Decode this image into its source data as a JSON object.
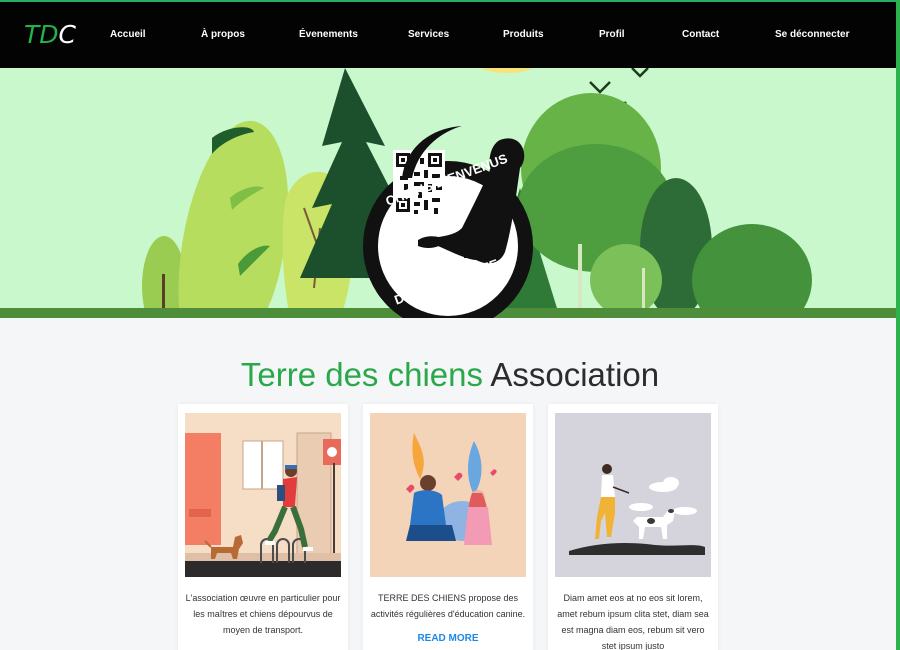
{
  "navbar": {
    "brand_part1": "TD",
    "brand_part2": "C",
    "items": [
      {
        "label": "Accueil"
      },
      {
        "label": "À propos"
      },
      {
        "label": "Évenements"
      },
      {
        "label": "Services"
      },
      {
        "label": "Produits"
      },
      {
        "label": "Profil"
      },
      {
        "label": "Contact"
      },
      {
        "label": "Se déconnecter"
      }
    ]
  },
  "hero": {
    "badge_top": "CHIENS BIENVENUS",
    "badge_bottom": "DOGS WELCOME"
  },
  "section": {
    "title_green": "Terre des chiens",
    "title_dark": "Association"
  },
  "cards": [
    {
      "text": "L'association œuvre en particulier pour les maîtres et chiens dépourvus de moyen de transport."
    },
    {
      "text": "TERRE DES CHIENS propose des activités régulières d'éducation canine.",
      "link": "READ MORE"
    },
    {
      "text": "Diam amet eos at no eos sit lorem, amet rebum ipsum clita stet, diam sea est magna diam eos, rebum sit vero stet ipsum justo"
    }
  ],
  "colors": {
    "accent_green": "#2aa84a",
    "navbar_bg": "#030303",
    "hero_bg": "#caf8cd",
    "link_blue": "#1e88e5"
  }
}
